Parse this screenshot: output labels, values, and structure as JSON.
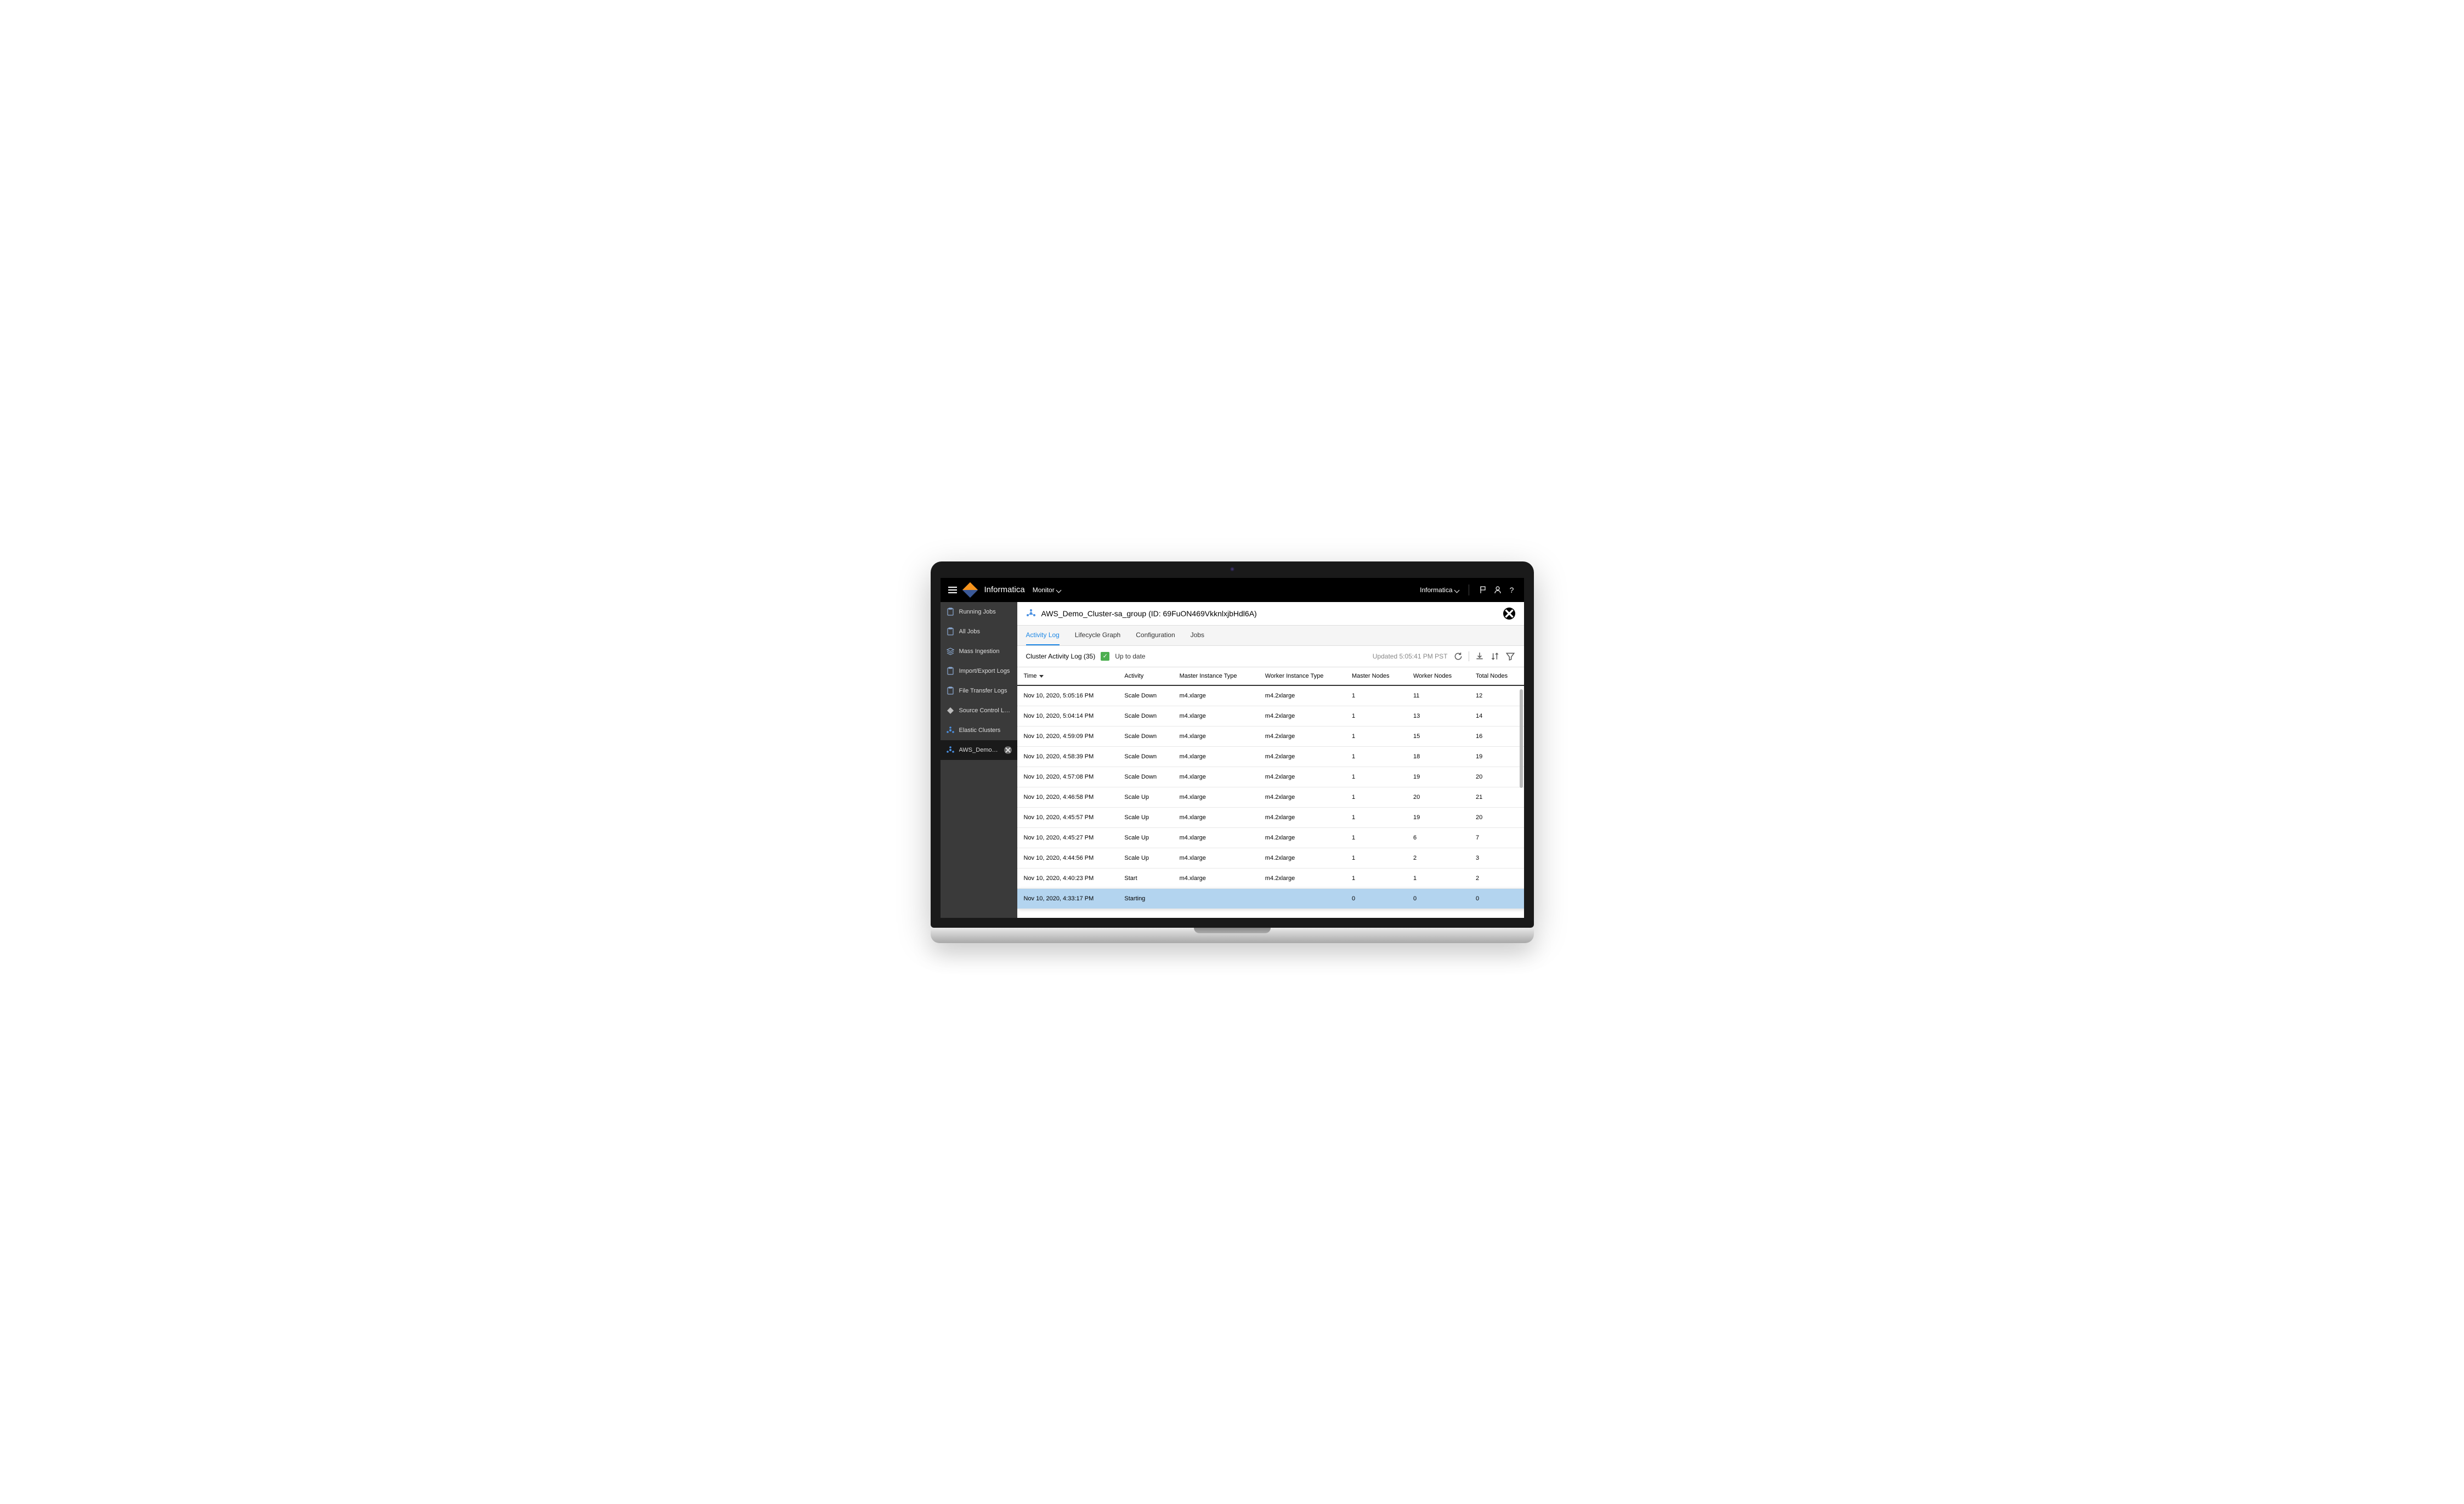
{
  "header": {
    "brand": "Informatica",
    "app_switcher": "Monitor",
    "org_switcher": "Informatica"
  },
  "sidebar": {
    "items": [
      {
        "label": "Running Jobs",
        "icon": "clipboard-icon"
      },
      {
        "label": "All Jobs",
        "icon": "clipboard-icon"
      },
      {
        "label": "Mass Ingestion",
        "icon": "stack-icon"
      },
      {
        "label": "Import/Export Logs",
        "icon": "clipboard-icon"
      },
      {
        "label": "File Transfer Logs",
        "icon": "clipboard-icon"
      },
      {
        "label": "Source Control Logs",
        "icon": "diamond-icon"
      },
      {
        "label": "Elastic Clusters",
        "icon": "cluster-icon"
      },
      {
        "label": "AWS_Demo_Cluste...",
        "icon": "cluster-icon",
        "active": true,
        "closable": true
      }
    ]
  },
  "page": {
    "title": "AWS_Demo_Cluster-sa_group (ID: 69FuON469VkknlxjbHdl6A)"
  },
  "tabs": [
    {
      "label": "Activity Log",
      "active": true
    },
    {
      "label": "Lifecycle Graph"
    },
    {
      "label": "Configuration"
    },
    {
      "label": "Jobs"
    }
  ],
  "toolbar": {
    "title": "Cluster Activity Log (35)",
    "status": "Up to date",
    "updated": "Updated 5:05:41 PM PST"
  },
  "table": {
    "columns": [
      "Time",
      "Activity",
      "Master Instance Type",
      "Worker Instance Type",
      "Master Nodes",
      "Worker Nodes",
      "Total Nodes"
    ],
    "sort_column": 0,
    "rows": [
      {
        "cells": [
          "Nov 10, 2020, 5:05:16 PM",
          "Scale Down",
          "m4.xlarge",
          "m4.2xlarge",
          "1",
          "11",
          "12"
        ]
      },
      {
        "cells": [
          "Nov 10, 2020, 5:04:14 PM",
          "Scale Down",
          "m4.xlarge",
          "m4.2xlarge",
          "1",
          "13",
          "14"
        ]
      },
      {
        "cells": [
          "Nov 10, 2020, 4:59:09 PM",
          "Scale Down",
          "m4.xlarge",
          "m4.2xlarge",
          "1",
          "15",
          "16"
        ]
      },
      {
        "cells": [
          "Nov 10, 2020, 4:58:39 PM",
          "Scale Down",
          "m4.xlarge",
          "m4.2xlarge",
          "1",
          "18",
          "19"
        ]
      },
      {
        "cells": [
          "Nov 10, 2020, 4:57:08 PM",
          "Scale Down",
          "m4.xlarge",
          "m4.2xlarge",
          "1",
          "19",
          "20"
        ]
      },
      {
        "cells": [
          "Nov 10, 2020, 4:46:58 PM",
          "Scale Up",
          "m4.xlarge",
          "m4.2xlarge",
          "1",
          "20",
          "21"
        ]
      },
      {
        "cells": [
          "Nov 10, 2020, 4:45:57 PM",
          "Scale Up",
          "m4.xlarge",
          "m4.2xlarge",
          "1",
          "19",
          "20"
        ]
      },
      {
        "cells": [
          "Nov 10, 2020, 4:45:27 PM",
          "Scale Up",
          "m4.xlarge",
          "m4.2xlarge",
          "1",
          "6",
          "7"
        ]
      },
      {
        "cells": [
          "Nov 10, 2020, 4:44:56 PM",
          "Scale Up",
          "m4.xlarge",
          "m4.2xlarge",
          "1",
          "2",
          "3"
        ]
      },
      {
        "cells": [
          "Nov 10, 2020, 4:40:23 PM",
          "Start",
          "m4.xlarge",
          "m4.2xlarge",
          "1",
          "1",
          "2"
        ]
      },
      {
        "cells": [
          "Nov 10, 2020, 4:33:17 PM",
          "Starting",
          "",
          "",
          "0",
          "0",
          "0"
        ],
        "selected": true
      }
    ]
  }
}
